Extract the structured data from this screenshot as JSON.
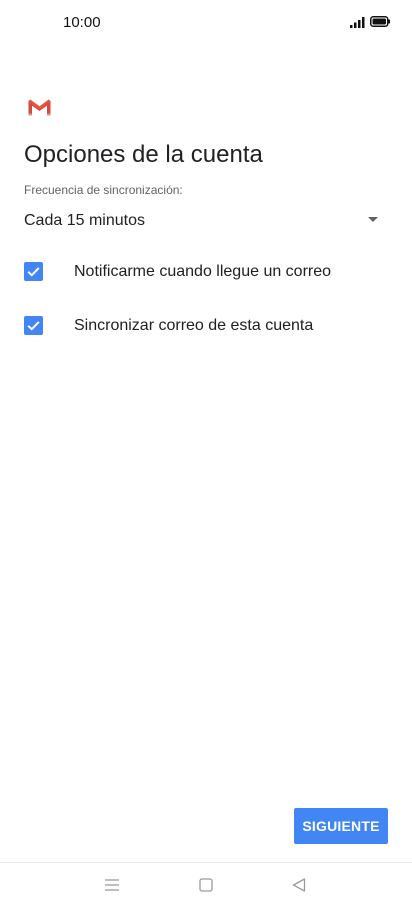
{
  "status_bar": {
    "time": "10:00",
    "icons": [
      "signal-icon",
      "battery-icon"
    ]
  },
  "app": {
    "logo": "gmail-logo-icon"
  },
  "page": {
    "title": "Opciones de la cuenta"
  },
  "sync_frequency": {
    "label": "Frecuencia de sincronización:",
    "value": "Cada 15 minutos"
  },
  "options": [
    {
      "label": "Notificarme cuando llegue un correo",
      "checked": true
    },
    {
      "label": "Sincronizar correo de esta cuenta",
      "checked": true
    }
  ],
  "actions": {
    "next_label": "SIGUIENTE"
  },
  "nav": {
    "icons": [
      "menu-icon",
      "home-icon",
      "back-icon"
    ]
  },
  "colors": {
    "accent": "#4285f4",
    "gmail_red": "#EA4335"
  }
}
